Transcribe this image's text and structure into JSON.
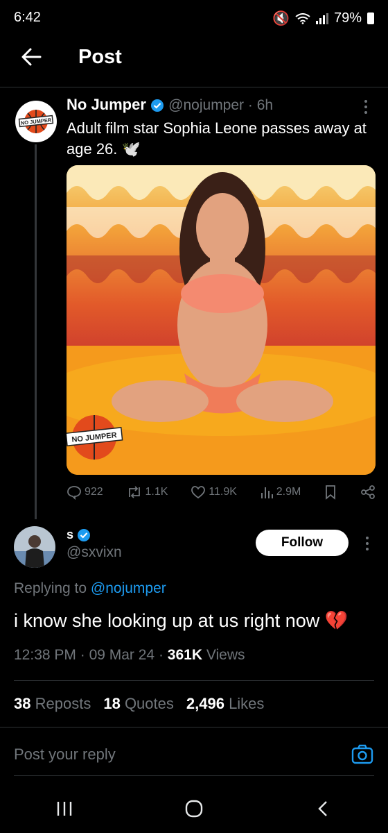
{
  "status_bar": {
    "time": "6:42",
    "battery": "79%"
  },
  "header": {
    "title": "Post"
  },
  "tweet": {
    "author_name": "No Jumper",
    "handle": "@nojumper",
    "age": "6h",
    "text": "Adult film star Sophia Leone passes away at age 26. 🕊️",
    "avatar_text": "NO JUMPER",
    "media_watermark": "NO JUMPER",
    "stats": {
      "replies": "922",
      "reposts": "1.1K",
      "likes": "11.9K",
      "views": "2.9M"
    }
  },
  "reply": {
    "author_name": "s",
    "handle": "@sxvixn",
    "follow_label": "Follow",
    "replying_prefix": "Replying to ",
    "replying_mention": "@nojumper",
    "text": "i know she looking up at us right now 💔",
    "time": "12:38 PM",
    "date": "09 Mar 24",
    "views_count": "361K",
    "views_label": "Views",
    "reposts_count": "38",
    "reposts_label": "Reposts",
    "quotes_count": "18",
    "quotes_label": "Quotes",
    "likes_count": "2,496",
    "likes_label": "Likes"
  },
  "composer": {
    "placeholder": "Post your reply"
  },
  "colors": {
    "accent": "#1d9bf0",
    "background": "#000000",
    "muted": "#71767b"
  },
  "icons": [
    "back-arrow-icon",
    "verified-icon",
    "more-icon",
    "reply-icon",
    "repost-icon",
    "like-icon",
    "views-icon",
    "bookmark-icon",
    "share-icon",
    "camera-icon",
    "recents-icon",
    "home-icon",
    "back-icon"
  ]
}
